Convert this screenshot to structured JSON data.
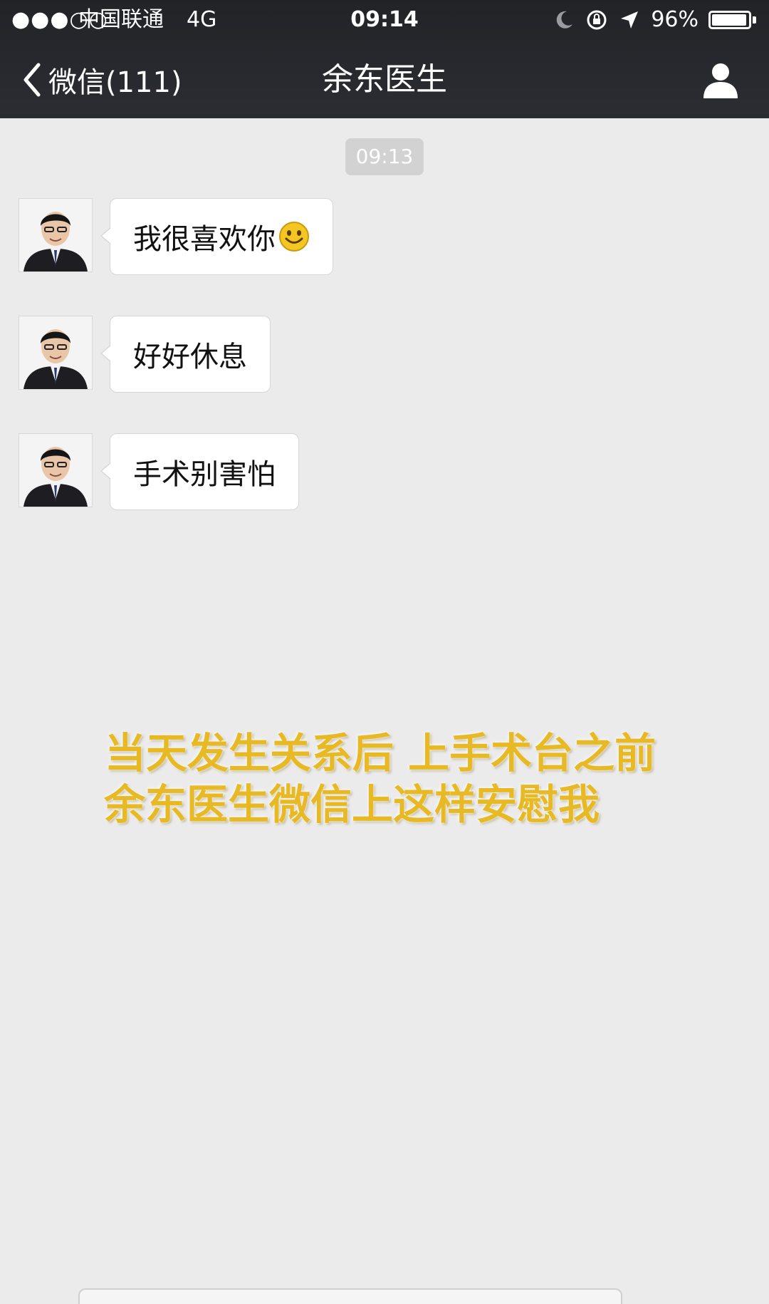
{
  "status_bar": {
    "signal": "●●●○○",
    "carrier": "中国联通",
    "network": "4G",
    "time": "09:14",
    "battery": "96%",
    "battery_level": 0.96,
    "icons": [
      "moon-icon",
      "orientation-lock-icon",
      "location-arrow-icon",
      "battery-icon"
    ]
  },
  "nav": {
    "back_label": "微信(111)",
    "title": "余东医生"
  },
  "chat": {
    "timestamp": "09:13",
    "messages": [
      {
        "text": "我很喜欢你",
        "emoji": "smiley-emoji"
      },
      {
        "text": "好好休息"
      },
      {
        "text": "手术别害怕"
      }
    ]
  },
  "overlay": {
    "line1": "当天发生关系后 上手术台之前",
    "line2": "余东医生微信上这样安慰我",
    "color": "#e6b925"
  }
}
